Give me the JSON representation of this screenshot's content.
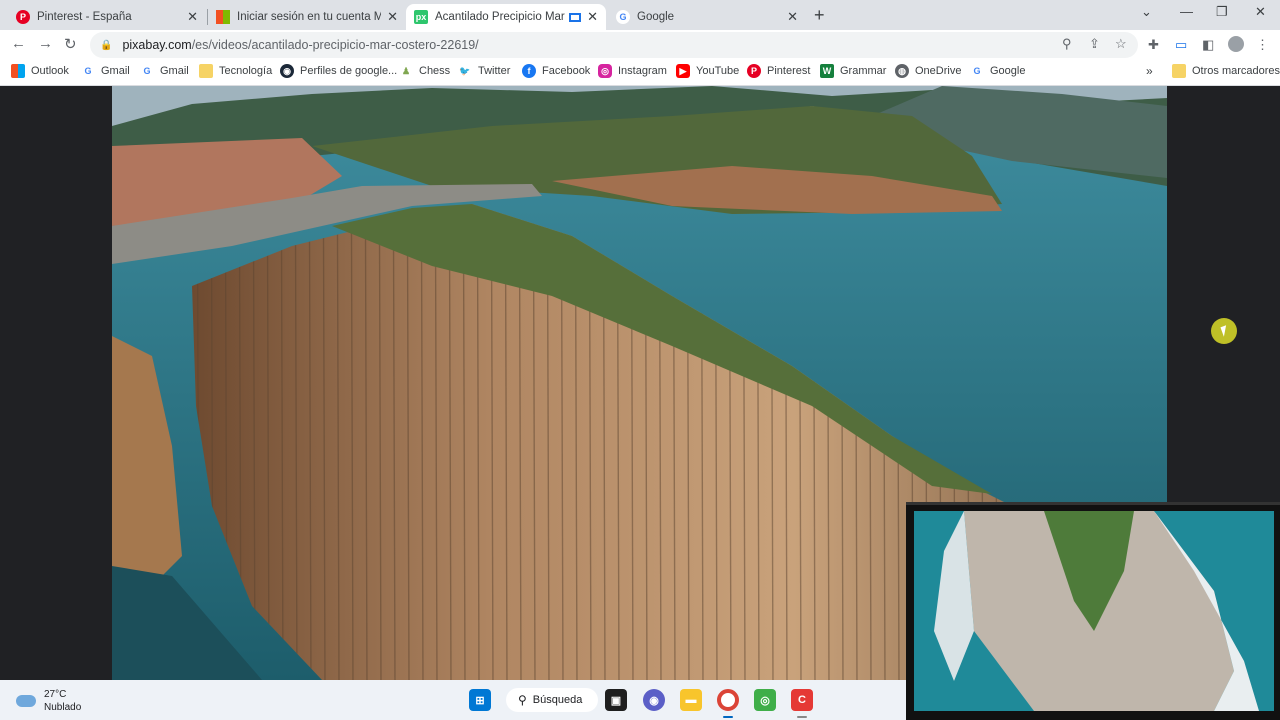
{
  "tabs": [
    {
      "title": "Pinterest - España",
      "favicon": "pinterest-icon",
      "color": "#e60023"
    },
    {
      "title": "Iniciar sesión en tu cuenta Microsoft",
      "favicon": "microsoft-icon",
      "color": "#f25022"
    },
    {
      "title": "Acantilado Precipicio Mar - Pixabay",
      "favicon": "pixabay-icon",
      "color": "#2ec66d",
      "active": true
    },
    {
      "title": "Google",
      "favicon": "google-icon",
      "color": "#4285f4"
    }
  ],
  "toolbar": {
    "url_host": "pixabay.com",
    "url_path": "/es/videos/acantilado-precipicio-mar-costero-22619/"
  },
  "bookmarks": [
    {
      "label": "Outlook",
      "icon": "microsoft-icon",
      "color": "#f25022"
    },
    {
      "label": "Gmail",
      "icon": "google-icon",
      "color": "#4285f4"
    },
    {
      "label": "Gmail",
      "icon": "google-icon",
      "color": "#4285f4"
    },
    {
      "label": "Tecnología",
      "icon": "folder-icon",
      "color": "#f6d365"
    },
    {
      "label": "Perfiles de google...",
      "icon": "steam-icon",
      "color": "#1b2838"
    },
    {
      "label": "Chess",
      "icon": "chess-pawn-icon",
      "color": "#7fa650"
    },
    {
      "label": "Twitter",
      "icon": "twitter-icon",
      "color": "#1da1f2"
    },
    {
      "label": "Facebook",
      "icon": "facebook-icon",
      "color": "#1877f2"
    },
    {
      "label": "Instagram",
      "icon": "instagram-icon",
      "color": "#d6249f"
    },
    {
      "label": "YouTube",
      "icon": "youtube-icon",
      "color": "#ff0000"
    },
    {
      "label": "Pinterest",
      "icon": "pinterest-icon",
      "color": "#e60023"
    },
    {
      "label": "Grammar",
      "icon": "grammar-icon",
      "color": "#15803d"
    },
    {
      "label": "OneDrive",
      "icon": "globe-icon",
      "color": "#5f6368"
    },
    {
      "label": "Google",
      "icon": "google-icon",
      "color": "#4285f4"
    }
  ],
  "other_bookmarks": "Otros marcadores",
  "taskbar": {
    "temp": "27°C",
    "condition": "Nublado",
    "search_label": "Búsqueda"
  }
}
